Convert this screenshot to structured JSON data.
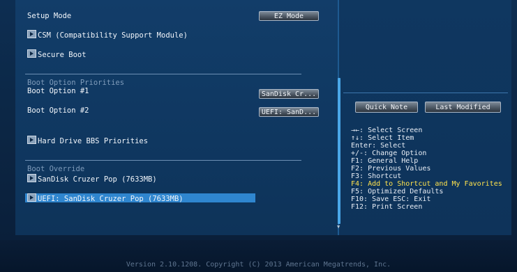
{
  "left_panel": {
    "setup_mode_label": "Setup Mode",
    "setup_mode_button": "EZ Mode",
    "csm_label": "CSM (Compatibility Support Module)",
    "secure_boot_label": "Secure Boot",
    "boot_option_priorities_header": "Boot Option Priorities",
    "boot_option_1_label": "Boot Option #1",
    "boot_option_1_value": "SanDisk Cr...",
    "boot_option_2_label": "Boot Option #2",
    "boot_option_2_value": "UEFI: SanD...",
    "hdd_bbs_label": "Hard Drive BBS Priorities",
    "boot_override_header": "Boot Override",
    "override_items": [
      "SanDisk Cruzer Pop  (7633MB)",
      "UEFI: SanDisk Cruzer Pop (7633MB)"
    ]
  },
  "right_panel": {
    "quick_note_button": "Quick Note",
    "last_modified_button": "Last Modified",
    "help_lines": [
      "→←: Select Screen",
      "↑↓: Select Item",
      "Enter: Select",
      "+/-: Change Option",
      "F1: General Help",
      "F2: Previous Values",
      "F3: Shortcut",
      "F4: Add to Shortcut and My Favorites",
      "F5: Optimized Defaults",
      "F10: Save  ESC: Exit",
      "F12: Print Screen"
    ],
    "highlight_color": "#ffe34d"
  },
  "footer": "Version 2.10.1208. Copyright (C) 2013 American Megatrends, Inc.",
  "colors": {
    "selection": "#2f86cf",
    "scrollbar": "#4aa7e8"
  },
  "icons": [
    "submenu-arrow-icon",
    "scroll-down-arrow-icon"
  ]
}
